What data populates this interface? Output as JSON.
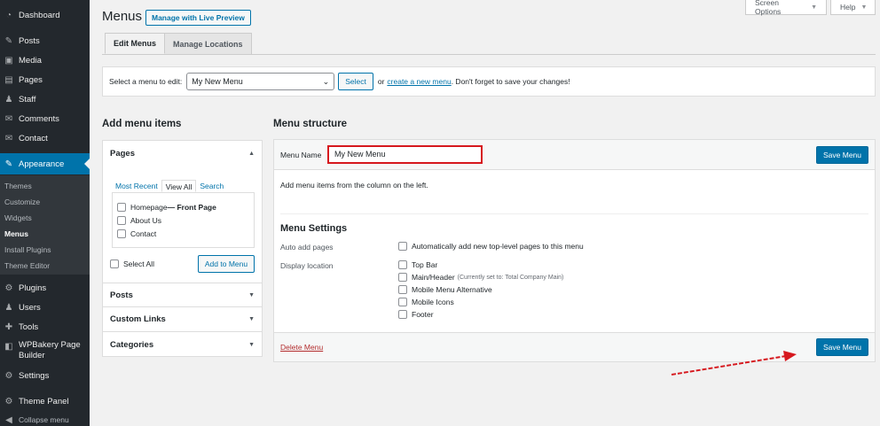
{
  "sidebar": {
    "items": [
      {
        "label": "Dashboard",
        "icon": "dashboard-icon",
        "glyph": "◔"
      },
      {
        "label": "Posts",
        "icon": "pin-icon",
        "glyph": "✎"
      },
      {
        "label": "Media",
        "icon": "media-icon",
        "glyph": "▣"
      },
      {
        "label": "Pages",
        "icon": "pages-icon",
        "glyph": "▤"
      },
      {
        "label": "Staff",
        "icon": "staff-icon",
        "glyph": "♟"
      },
      {
        "label": "Comments",
        "icon": "comments-icon",
        "glyph": "✉"
      },
      {
        "label": "Contact",
        "icon": "contact-icon",
        "glyph": "✉"
      },
      {
        "label": "Appearance",
        "icon": "appearance-icon",
        "glyph": "✎"
      },
      {
        "label": "Plugins",
        "icon": "plugins-icon",
        "glyph": "⚙"
      },
      {
        "label": "Users",
        "icon": "users-icon",
        "glyph": "♟"
      },
      {
        "label": "Tools",
        "icon": "tools-icon",
        "glyph": "✚"
      },
      {
        "label": "WPBakery Page Builder",
        "icon": "wpbakery-icon",
        "glyph": "◧"
      },
      {
        "label": "Settings",
        "icon": "settings-icon",
        "glyph": "⚙"
      },
      {
        "label": "Theme Panel",
        "icon": "theme-panel-icon",
        "glyph": "⚙"
      },
      {
        "label": "Collapse menu",
        "icon": "collapse-icon",
        "glyph": "◀"
      }
    ],
    "wpbakery_line1": "WPBakery Page",
    "wpbakery_line2": "Builder",
    "submenu": [
      "Themes",
      "Customize",
      "Widgets",
      "Menus",
      "Install Plugins",
      "Theme Editor"
    ]
  },
  "header": {
    "title": "Menus",
    "live_preview": "Manage with Live Preview",
    "screen_options": "Screen Options",
    "help": "Help"
  },
  "tabs": {
    "edit": "Edit Menus",
    "manage": "Manage Locations"
  },
  "select_bar": {
    "label": "Select a menu to edit:",
    "selected": "My New Menu",
    "button": "Select",
    "or": "or",
    "create_link": "create a new menu",
    "suffix": ". Don't forget to save your changes!"
  },
  "left": {
    "heading": "Add menu items",
    "pages_title": "Pages",
    "page_tabs": [
      "Most Recent",
      "View All",
      "Search"
    ],
    "pages": [
      {
        "name": "Homepage",
        "suffix": " — Front Page"
      },
      {
        "name": "About Us",
        "suffix": ""
      },
      {
        "name": "Contact",
        "suffix": ""
      }
    ],
    "select_all": "Select All",
    "add_button": "Add to Menu",
    "sections": [
      "Posts",
      "Custom Links",
      "Categories"
    ]
  },
  "right": {
    "heading": "Menu structure",
    "menu_name_label": "Menu Name",
    "menu_name_value": "My New Menu",
    "save": "Save Menu",
    "instructions": "Add menu items from the column on the left.",
    "settings_title": "Menu Settings",
    "auto_add_label": "Auto add pages",
    "auto_add_text": "Automatically add new top-level pages to this menu",
    "display_location_label": "Display location",
    "locations": [
      {
        "name": "Top Bar",
        "note": ""
      },
      {
        "name": "Main/Header",
        "note": "(Currently set to: Total Company Main)"
      },
      {
        "name": "Mobile Menu Alternative",
        "note": ""
      },
      {
        "name": "Mobile Icons",
        "note": ""
      },
      {
        "name": "Footer",
        "note": ""
      }
    ],
    "delete": "Delete Menu"
  },
  "colors": {
    "accent": "#0073aa",
    "sidebar_bg": "#23282d",
    "highlight_red": "#d6181e"
  }
}
